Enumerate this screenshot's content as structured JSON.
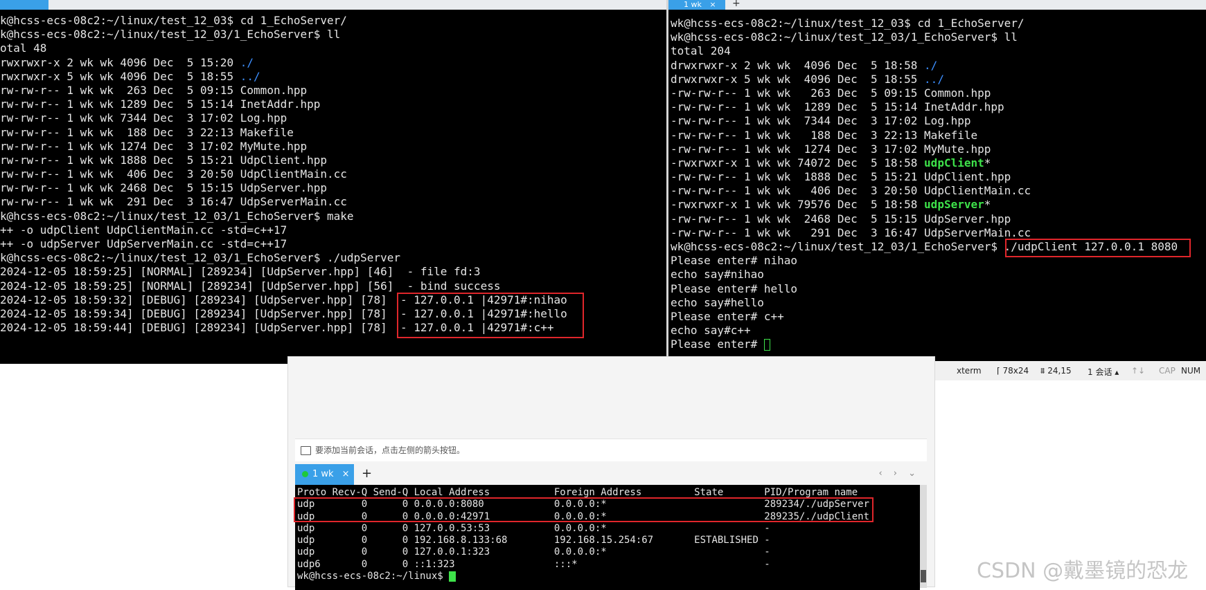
{
  "top_right_tab": {
    "label": "1 wk",
    "close": "×",
    "plus": "+"
  },
  "left_terminal": {
    "lines": [
      "k@hcss-ecs-08c2:~/linux/test_12_03$ cd 1_EchoServer/",
      "k@hcss-ecs-08c2:~/linux/test_12_03/1_EchoServer$ ll",
      "otal 48",
      "rwxrwxr-x 2 wk wk 4096 Dec  5 15:20 ",
      "rwxrwxr-x 5 wk wk 4096 Dec  5 18:55 ",
      "rw-rw-r-- 1 wk wk  263 Dec  5 09:15 Common.hpp",
      "rw-rw-r-- 1 wk wk 1289 Dec  5 15:14 InetAddr.hpp",
      "rw-rw-r-- 1 wk wk 7344 Dec  3 17:02 Log.hpp",
      "rw-rw-r-- 1 wk wk  188 Dec  3 22:13 Makefile",
      "rw-rw-r-- 1 wk wk 1274 Dec  3 17:02 MyMute.hpp",
      "rw-rw-r-- 1 wk wk 1888 Dec  5 15:21 UdpClient.hpp",
      "rw-rw-r-- 1 wk wk  406 Dec  3 20:50 UdpClientMain.cc",
      "rw-rw-r-- 1 wk wk 2468 Dec  5 15:15 UdpServer.hpp",
      "rw-rw-r-- 1 wk wk  291 Dec  3 16:47 UdpServerMain.cc",
      "k@hcss-ecs-08c2:~/linux/test_12_03/1_EchoServer$ make",
      "++ -o udpClient UdpClientMain.cc -std=c++17",
      "++ -o udpServer UdpServerMain.cc -std=c++17",
      "k@hcss-ecs-08c2:~/linux/test_12_03/1_EchoServer$ ./udpServer",
      "2024-12-05 18:59:25] [NORMAL] [289234] [UdpServer.hpp] [46]  - file fd:3",
      "2024-12-05 18:59:25] [NORMAL] [289234] [UdpServer.hpp] [56]  - bind success",
      "2024-12-05 18:59:32] [DEBUG] [289234] [UdpServer.hpp] [78]  - 127.0.0.1 |42971#:nihao",
      "2024-12-05 18:59:34] [DEBUG] [289234] [UdpServer.hpp] [78]  - 127.0.0.1 |42971#:hello",
      "2024-12-05 18:59:44] [DEBUG] [289234] [UdpServer.hpp] [78]  - 127.0.0.1 |42971#:c++"
    ],
    "dir_dot": "./",
    "dir_dotdot": "../"
  },
  "right_terminal": {
    "lines": [
      "wk@hcss-ecs-08c2:~/linux/test_12_03$ cd 1_EchoServer/",
      "wk@hcss-ecs-08c2:~/linux/test_12_03/1_EchoServer$ ll",
      "total 204",
      "drwxrwxr-x 2 wk wk  4096 Dec  5 18:58 ",
      "drwxrwxr-x 5 wk wk  4096 Dec  5 18:55 ",
      "-rw-rw-r-- 1 wk wk   263 Dec  5 09:15 Common.hpp",
      "-rw-rw-r-- 1 wk wk  1289 Dec  5 15:14 InetAddr.hpp",
      "-rw-rw-r-- 1 wk wk  7344 Dec  3 17:02 Log.hpp",
      "-rw-rw-r-- 1 wk wk   188 Dec  3 22:13 Makefile",
      "-rw-rw-r-- 1 wk wk  1274 Dec  3 17:02 MyMute.hpp",
      "-rwxrwxr-x 1 wk wk 74072 Dec  5 18:58 ",
      "-rw-rw-r-- 1 wk wk  1888 Dec  5 15:21 UdpClient.hpp",
      "-rw-rw-r-- 1 wk wk   406 Dec  3 20:50 UdpClientMain.cc",
      "-rwxrwxr-x 1 wk wk 79576 Dec  5 18:58 ",
      "-rw-rw-r-- 1 wk wk  2468 Dec  5 15:15 UdpServer.hpp",
      "-rw-rw-r-- 1 wk wk   291 Dec  3 16:47 UdpServerMain.cc",
      "wk@hcss-ecs-08c2:~/linux/test_12_03/1_EchoServer$ ",
      "Please enter# nihao",
      "echo say#nihao",
      "Please enter# hello",
      "echo say#hello",
      "Please enter# c++",
      "echo say#c++",
      "Please enter# "
    ],
    "dir_dot": "./",
    "dir_dotdot": "../",
    "exec_client": "udpClient",
    "exec_server": "udpServer",
    "exec_suffix": "*",
    "client_command": "./udpClient 127.0.0.1 8080"
  },
  "statusbar": {
    "term_type": "xterm",
    "size": "78x24",
    "cursor_pos": "24,15",
    "sessions": "1 会话",
    "caps": "CAP",
    "num": "NUM"
  },
  "lower_window": {
    "hint": "要添加当前会话，点击左侧的箭头按钮。",
    "tab_label": "1 wk",
    "tab_close": "×",
    "plus": "+",
    "nav": "‹ › ⌄",
    "lines": [
      "Proto Recv-Q Send-Q Local Address           Foreign Address         State       PID/Program name",
      "udp        0      0 0.0.0.0:8080            0.0.0.0:*                           289234/./udpServer",
      "udp        0      0 0.0.0.0:42971           0.0.0.0:*                           289235/./udpClient",
      "udp        0      0 127.0.0.53:53           0.0.0.0:*                           -",
      "udp        0      0 192.168.8.133:68        192.168.15.254:67       ESTABLISHED -",
      "udp        0      0 127.0.0.1:323           0.0.0.0:*                           -",
      "udp6       0      0 ::1:323                 :::*                                -",
      "wk@hcss-ecs-08c2:~/linux$ "
    ]
  },
  "watermark": "CSDN @戴墨镜的恐龙",
  "colors": {
    "terminal_bg": "#000000",
    "highlight": "#e0262b",
    "tab_blue": "#3aa0e8",
    "exec_green": "#3ee24a",
    "dir_blue": "#3d8fff"
  }
}
